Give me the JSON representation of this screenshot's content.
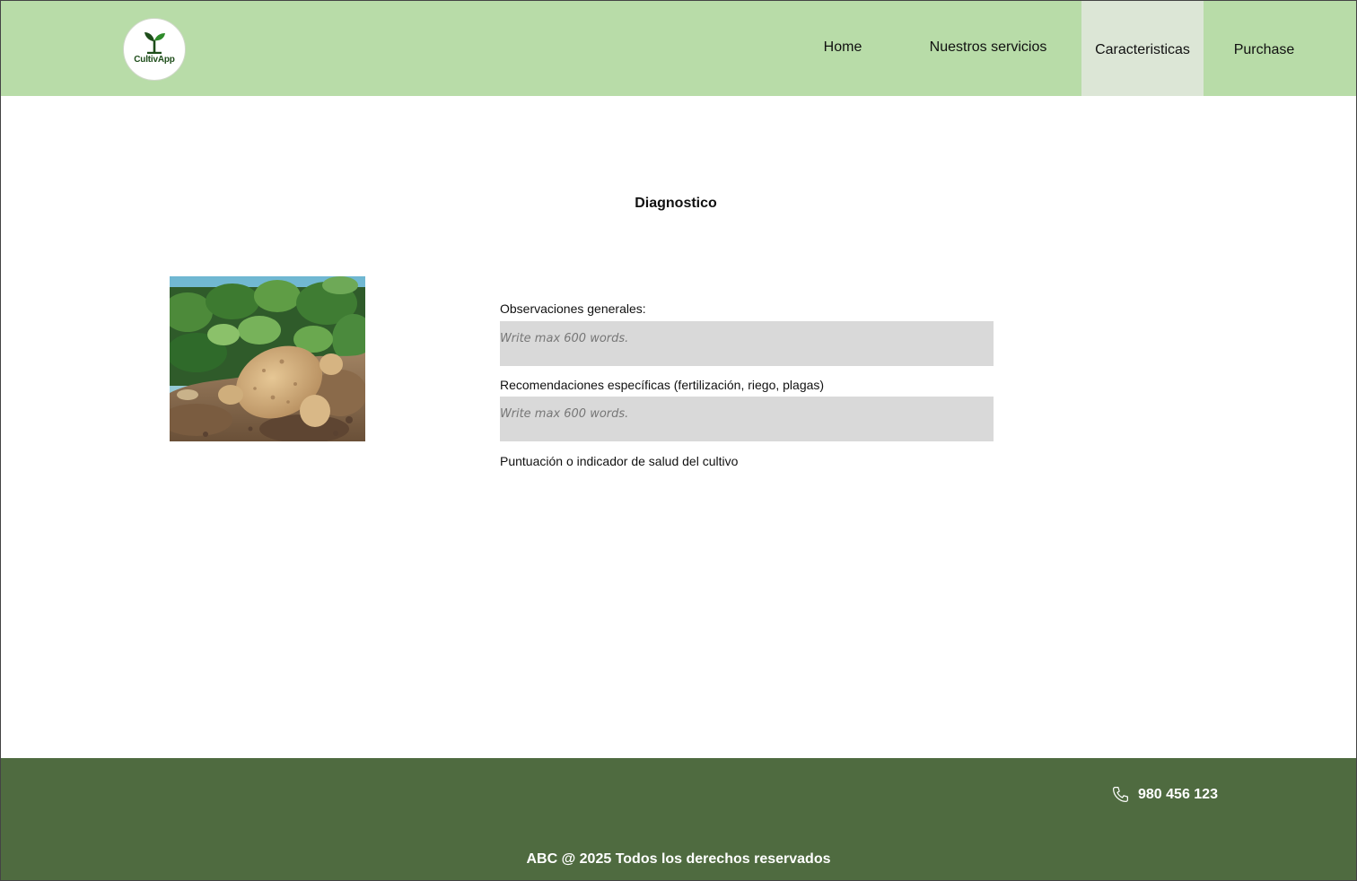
{
  "header": {
    "logo_text": "CultivApp",
    "nav": {
      "home": "Home",
      "services": "Nuestros servicios",
      "features": "Caracteristicas",
      "purchase": "Purchase"
    },
    "active_tab": "Caracteristicas"
  },
  "main": {
    "title": "Diagnostico",
    "image": {
      "icon": "potato-crop-photo"
    },
    "fields": {
      "observations_label": "Observaciones generales:",
      "observations_placeholder": "Write max 600 words.",
      "recommendations_label": "Recomendaciones específicas (fertilización, riego, plagas)",
      "recommendations_placeholder": "Write max 600 words.",
      "score_label": "Puntuación o indicador de salud del cultivo"
    }
  },
  "footer": {
    "phone": "980 456 123",
    "phone_icon": "phone-icon",
    "copyright": "ABC @ 2025 Todos los derechos reservados"
  },
  "colors": {
    "header_bg": "#b8dca8",
    "active_tab_bg": "#dce6d6",
    "footer_bg": "#4f6b40",
    "textbox_bg": "#d9d9d9"
  }
}
